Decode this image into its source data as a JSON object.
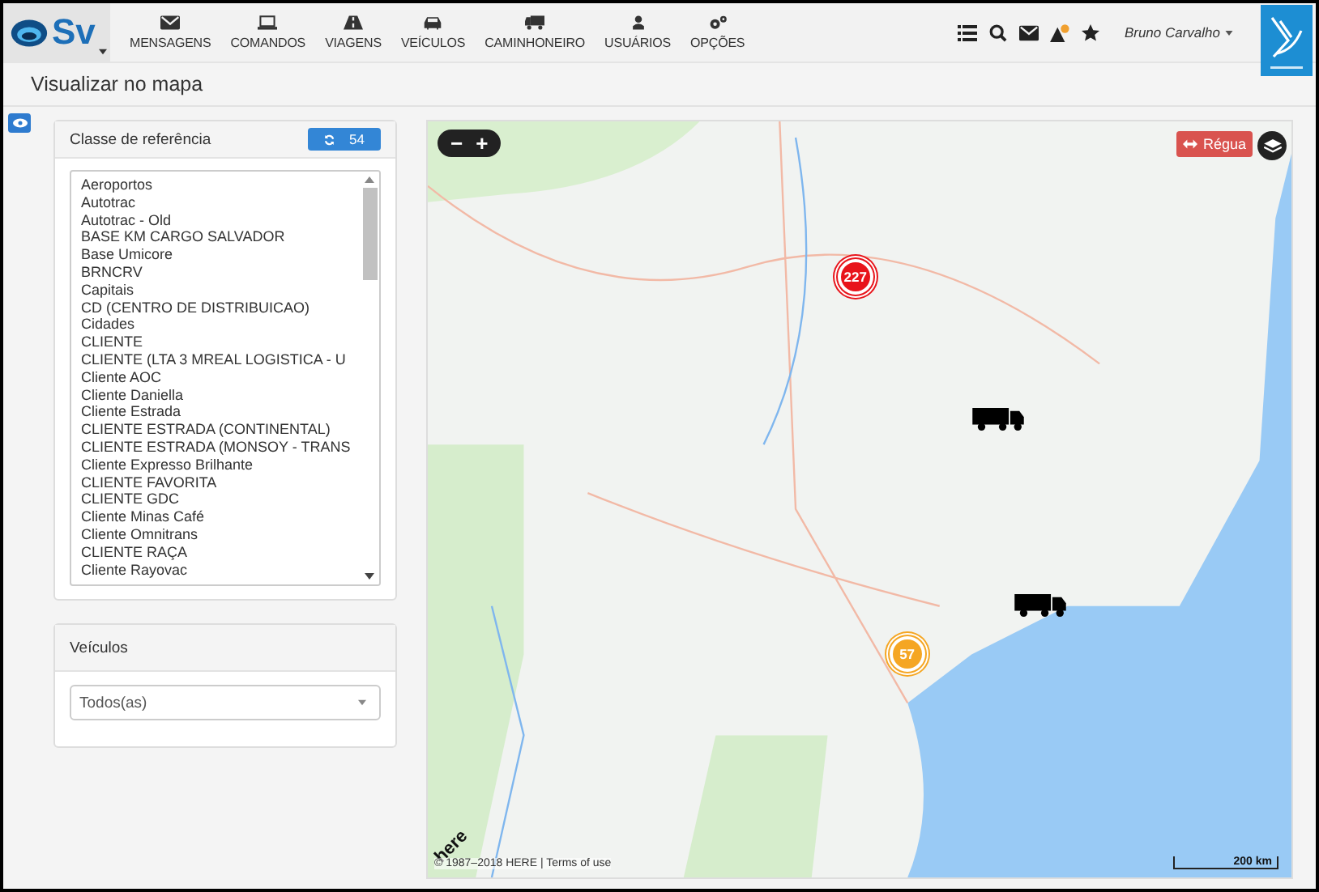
{
  "header": {
    "logo": "Sv",
    "nav": [
      {
        "label": "MENSAGENS"
      },
      {
        "label": "COMANDOS"
      },
      {
        "label": "VIAGENS"
      },
      {
        "label": "VEÍCULOS"
      },
      {
        "label": "CAMINHONEIRO"
      },
      {
        "label": "USUÁRIOS"
      },
      {
        "label": "OPÇÕES"
      }
    ],
    "user": "Bruno Carvalho"
  },
  "page_title": "Visualizar no mapa",
  "reference_panel": {
    "title": "Classe de referência",
    "refresh_count": "54",
    "items": [
      "Aeroportos",
      "Autotrac",
      "Autotrac - Old",
      "BASE KM CARGO SALVADOR",
      "Base Umicore",
      "BRNCRV",
      "Capitais",
      "CD (CENTRO DE DISTRIBUICAO)",
      "Cidades",
      "CLIENTE",
      "CLIENTE (LTA 3 MREAL LOGISTICA - U",
      "Cliente AOC",
      "Cliente Daniella",
      "Cliente Estrada",
      "CLIENTE ESTRADA (CONTINENTAL)",
      "CLIENTE ESTRADA (MONSOY - TRANS",
      "Cliente Expresso Brilhante",
      "CLIENTE FAVORITA",
      "CLIENTE GDC",
      "Cliente Minas Café",
      "Cliente Omnitrans",
      "CLIENTE RAÇA",
      "Cliente Rayovac"
    ]
  },
  "vehicles_panel": {
    "title": "Veículos",
    "value": "Todos(as)"
  },
  "map": {
    "zoom_out": "−",
    "zoom_in": "+",
    "ruler_button": "Régua",
    "clusters": [
      {
        "count": "227",
        "color": "#e8141b"
      },
      {
        "count": "57",
        "color": "#f5a623"
      }
    ],
    "logo": "here",
    "attribution": "© 1987–2018 HERE | Terms of use",
    "scale": "200 km"
  }
}
